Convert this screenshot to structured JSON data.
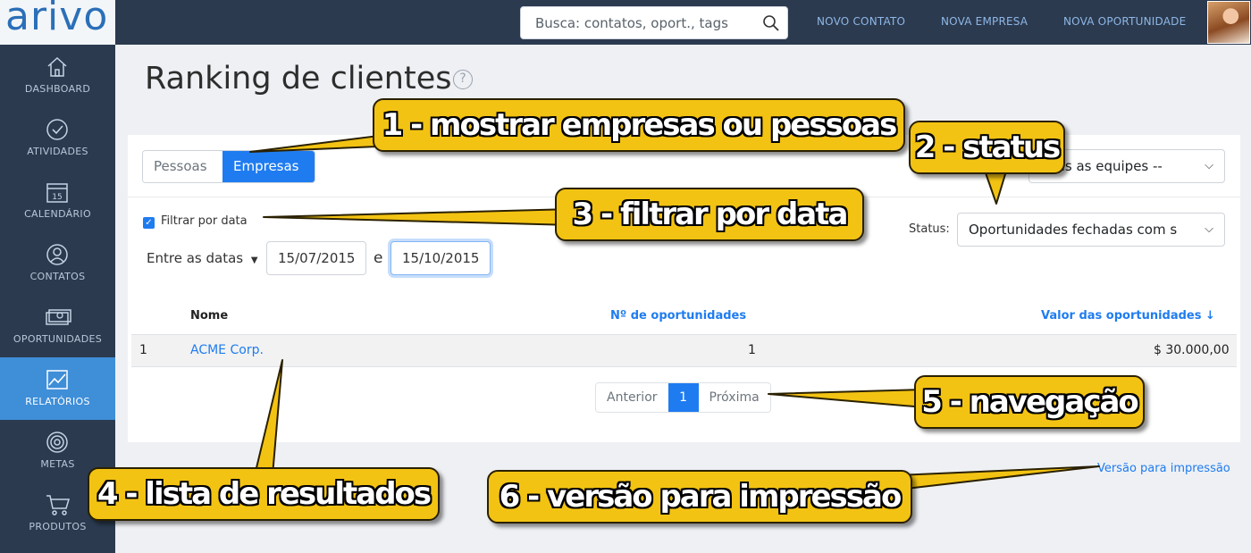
{
  "app": {
    "logo": "arivo"
  },
  "topbar": {
    "search_placeholder": "Busca: contatos, oport., tags",
    "nav": [
      "NOVO CONTATO",
      "NOVA EMPRESA",
      "NOVA OPORTUNIDADE"
    ]
  },
  "sidebar": {
    "items": [
      {
        "label": "DASHBOARD",
        "icon": "home-icon"
      },
      {
        "label": "ATIVIDADES",
        "icon": "check-circle-icon"
      },
      {
        "label": "CALENDÁRIO",
        "icon": "calendar-icon",
        "icon_text": "15"
      },
      {
        "label": "CONTATOS",
        "icon": "user-icon"
      },
      {
        "label": "OPORTUNIDADES",
        "icon": "money-icon"
      },
      {
        "label": "RELATÓRIOS",
        "icon": "chart-icon",
        "active": true
      },
      {
        "label": "METAS",
        "icon": "target-icon"
      },
      {
        "label": "PRODUTOS",
        "icon": "cart-icon"
      }
    ]
  },
  "page": {
    "title": "Ranking de clientes",
    "help": "?"
  },
  "filters": {
    "toggle": {
      "options": [
        "Pessoas",
        "Empresas"
      ],
      "selected": "Empresas"
    },
    "team_select": "odas as equipes --",
    "status_label": "Status:",
    "status_select": "Oportunidades fechadas com s",
    "date_filter_label": "Filtrar por data",
    "date_filter_checked": true,
    "date_mode": "Entre as datas",
    "date_from": "15/07/2015",
    "date_sep": "e",
    "date_to": "15/10/2015"
  },
  "table": {
    "headers": {
      "name": "Nome",
      "count": "Nº de oportunidades",
      "value": "Valor das oportunidades ↓"
    },
    "rows": [
      {
        "rank": "1",
        "name": "ACME Corp.",
        "count": "1",
        "value": "$ 30.000,00"
      }
    ]
  },
  "pagination": {
    "prev": "Anterior",
    "current": "1",
    "next": "Próxima"
  },
  "print_link": "Versão para impressão",
  "callouts": {
    "c1": "1 - mostrar empresas ou pessoas",
    "c2": "2 - status",
    "c3": "3 - filtrar por data",
    "c4": "4 - lista de resultados",
    "c5": "5 - navegação",
    "c6": "6 - versão para impressão"
  },
  "colors": {
    "sidebar": "#2b3a4f",
    "accent": "#1f7cf0",
    "active_nav": "#3f8ed8",
    "callout": "#f3c313"
  }
}
